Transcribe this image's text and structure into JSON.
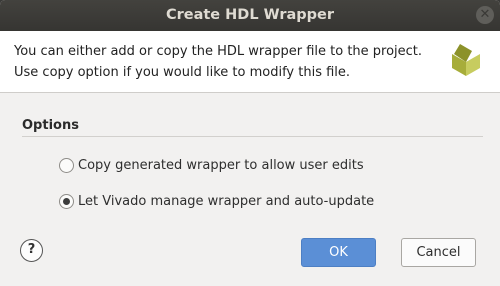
{
  "dialog": {
    "title": "Create HDL Wrapper",
    "close_icon": "close-icon",
    "header_text": "You can either add or copy the HDL wrapper file to the project. Use copy option if you would like to modify this file.",
    "logo_icon": "vivado-logo-icon"
  },
  "options": {
    "title": "Options",
    "choices": [
      {
        "label": "Copy generated wrapper to allow user edits",
        "selected": false
      },
      {
        "label": "Let Vivado manage wrapper and auto-update",
        "selected": true
      }
    ]
  },
  "footer": {
    "help_label": "?",
    "ok_label": "OK",
    "cancel_label": "Cancel"
  },
  "colors": {
    "titlebar": "#3c3b37",
    "ok_button": "#5b8fd6",
    "logo": "#a7ad3a"
  }
}
